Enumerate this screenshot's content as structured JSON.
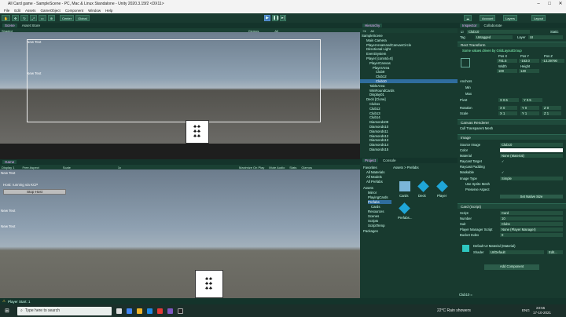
{
  "window": {
    "title": "All Card game - SampleScene - PC, Mac & Linux Standalone - Unity 2020.3.15f2 <DX11>"
  },
  "menu": [
    "File",
    "Edit",
    "Assets",
    "GameObject",
    "Component",
    "Window",
    "Help"
  ],
  "toolbar": {
    "pivot": "Pivot",
    "center": "Center",
    "global": "Global",
    "account": "Account",
    "layers": "Layers",
    "layout": "Layout"
  },
  "scene": {
    "tabs": [
      "Scene",
      "Asset Store"
    ],
    "shading": "Shaded",
    "gizmos": "Gizmos",
    "search": "All",
    "texts": [
      "New Text",
      "New Text"
    ]
  },
  "game": {
    "tabs": [
      "Game"
    ],
    "display": "Display 1",
    "aspect": "Free Aspect",
    "scale": "Scale",
    "scale_val": "1x",
    "options": [
      "Maximize On Play",
      "Mute Audio",
      "Stats",
      "Gizmos"
    ],
    "host_text": "Host: running via KCP",
    "stop_host": "Stop Host",
    "texts": [
      "New Text",
      "New Text",
      "New Text"
    ]
  },
  "hierarchy": {
    "tab": "Hierarchy",
    "search": "All",
    "rows": [
      "SampleScene",
      "Main Camera",
      "PlayerAreaHandCanvasCircle",
      "Directional Light",
      "EventSystem",
      "Player [connId=0]",
      "PlayerCanvas",
      "PlayerArea",
      "Club9",
      "Club12",
      "Club10",
      "TableArea",
      "WinRoundCards",
      "Display01",
      "Deck [Clone]",
      "Club11",
      "Club12",
      "Club13",
      "Club14",
      "Diamonds09",
      "Diamonds10",
      "Diamonds11",
      "Diamonds12",
      "Diamonds13",
      "Diamonds14",
      "Diamonds15"
    ]
  },
  "project": {
    "tabs": [
      "Project",
      "Console"
    ],
    "favorites": "Favorites",
    "fav_items": [
      "All Materials",
      "All Models",
      "All Prefabs"
    ],
    "assets": "Assets",
    "asset_folders": [
      "Mirror",
      "PlayingCards",
      "Prefabs",
      "Cards",
      "Resources",
      "Scenes",
      "Scripts",
      "ScriptTemp"
    ],
    "packages": "Packages",
    "breadcrumb": "Assets > Prefabs",
    "items": [
      "Cards",
      "Deck",
      "Player",
      "Prefabs..."
    ]
  },
  "inspector": {
    "tabs": [
      "Inspector",
      "Collaborate"
    ],
    "name": "Club10",
    "static": "Static",
    "tag_label": "Tag",
    "tag": "Untagged",
    "layer_label": "Layer",
    "layer": "UI",
    "rect": "Rect Transform",
    "rect_note": "Some values driven by GridLayoutGroup",
    "pos_labels": [
      "Pos X",
      "Pos Y",
      "Pos Z"
    ],
    "pos_vals": [
      "791.5",
      "-163.0",
      "-13.29790"
    ],
    "size_labels": [
      "Width",
      "Height"
    ],
    "size_vals": [
      "100",
      "140"
    ],
    "anchors": "Anchors",
    "min": "Min",
    "max": "Max",
    "pivot": "Pivot",
    "pivot_vals": [
      "X 0.5",
      "Y 0.5"
    ],
    "rotation": "Rotation",
    "rot_vals": [
      "X 0",
      "Y 0",
      "Z 0"
    ],
    "scale": "Scale",
    "scale_vals": [
      "X 1",
      "Y 1",
      "Z 1"
    ],
    "canvas_renderer": "Canvas Renderer",
    "cull": "Cull Transparent Mesh",
    "image": "Image",
    "source_image": "Source Image",
    "source_val": "Club10",
    "color": "Color",
    "material": "Material",
    "material_val": "None (Material)",
    "raycast": "Raycast Target",
    "raycast_pad": "Raycast Padding",
    "maskable": "Maskable",
    "image_type": "Image Type",
    "image_type_val": "Simple",
    "use_sprite": "Use Sprite Mesh",
    "preserve": "Preserve Aspect",
    "native": "Set Native Size",
    "card_script": "Card (Script)",
    "script_label": "Script",
    "script_val": "Card",
    "number": "Number",
    "number_val": "10",
    "suit": "Suit",
    "suit_val": "Clubs",
    "pms": "Player Manager Script",
    "pms_val": "None (Player Manager)",
    "bucket": "Bucket Index",
    "bucket_val": "0",
    "material_name": "Default UI Material (Material)",
    "shader": "Shader",
    "shader_val": "UI/Default",
    "edit": "Edit...",
    "add_component": "Add Component",
    "footer": "Club10 ="
  },
  "status": "Player Start: 1",
  "taskbar": {
    "search": "Type here to search",
    "weather": "22°C  Rain showers",
    "time": "23:55",
    "date": "17-10-2021",
    "lang": "ENG"
  },
  "colors": {
    "unity_green": "#183a2f",
    "selection": "#2f6d9e",
    "play_active": "#3f77b8"
  }
}
